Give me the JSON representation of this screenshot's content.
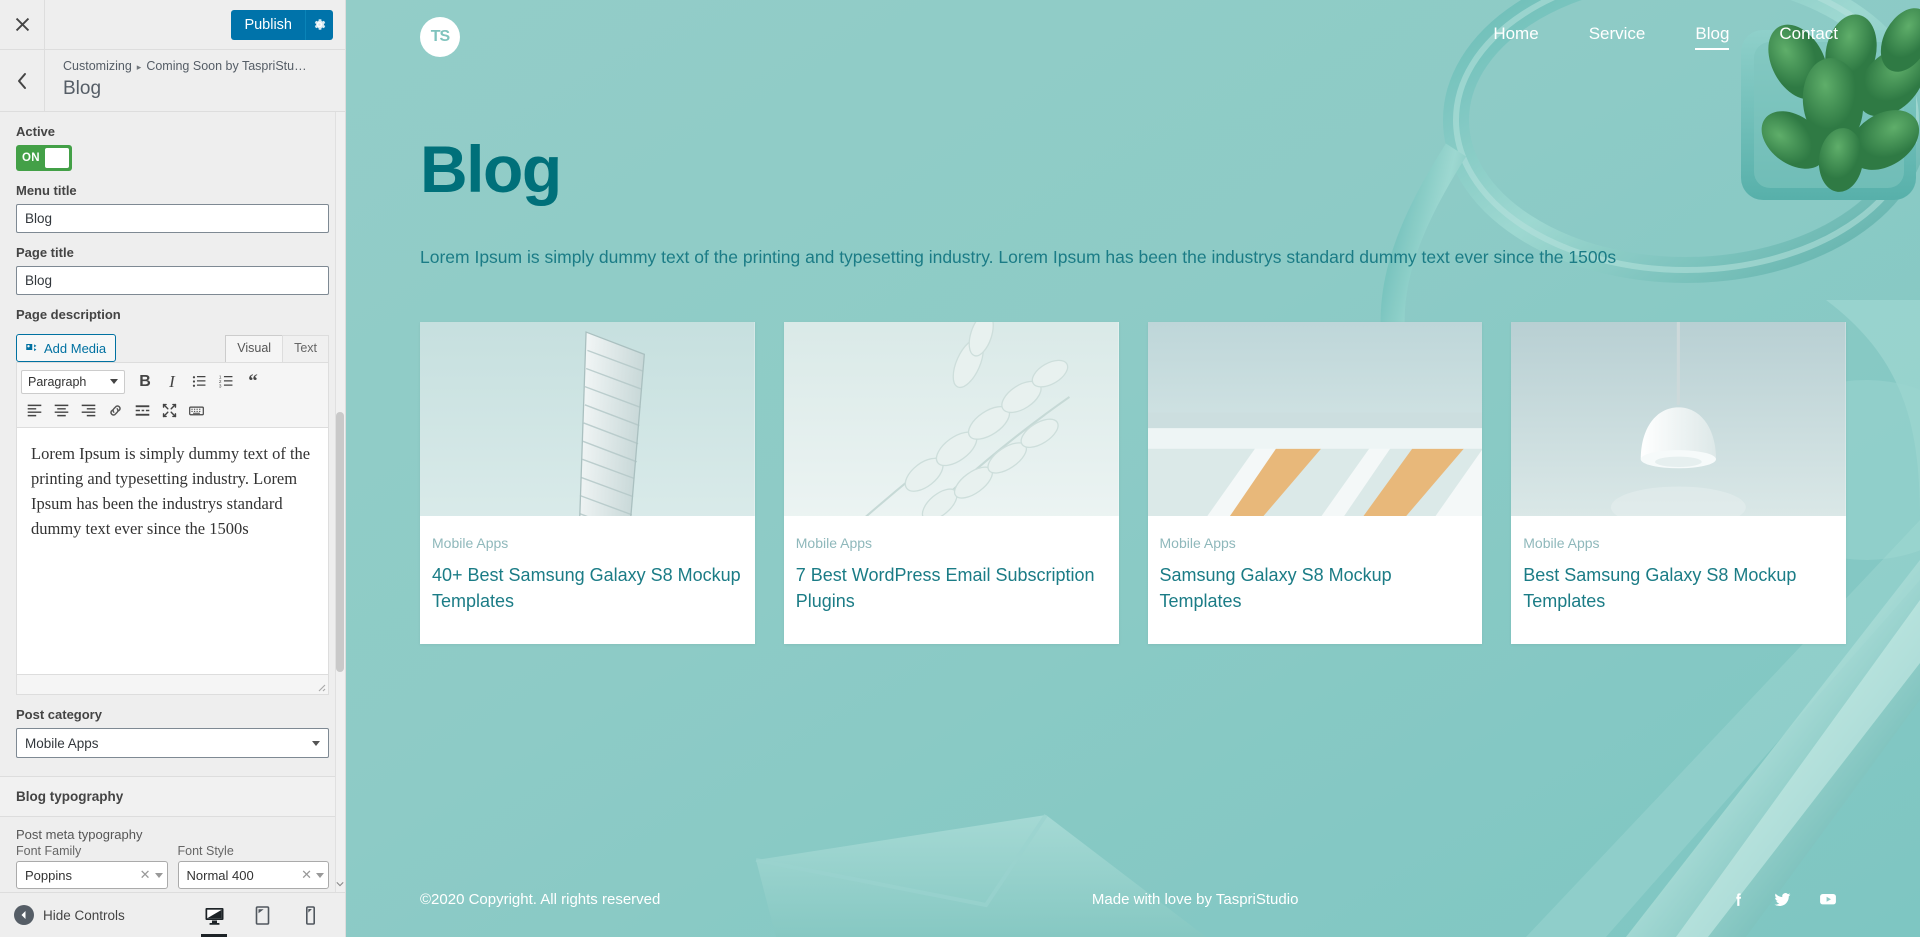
{
  "customizer": {
    "close_icon": "close-icon",
    "publish_label": "Publish",
    "gear_icon": "gear-icon",
    "back_icon": "chevron-left-icon",
    "breadcrumb_root": "Customizing",
    "breadcrumb_parent": "Coming Soon by TaspriStu…",
    "panel_title": "Blog",
    "controls": {
      "active_label": "Active",
      "active_state": "ON",
      "menu_title_label": "Menu title",
      "menu_title_value": "Blog",
      "page_title_label": "Page title",
      "page_title_value": "Blog",
      "page_description_label": "Page description",
      "add_media_label": "Add Media",
      "tab_visual": "Visual",
      "tab_text": "Text",
      "format_select": "Paragraph",
      "editor_content": "Lorem Ipsum is simply dummy text of the printing and typesetting industry. Lorem Ipsum has been the industrys standard dummy text ever since the 1500s",
      "post_category_label": "Post category",
      "post_category_value": "Mobile Apps"
    },
    "typography": {
      "section_title": "Blog typography",
      "subsection_title": "Post meta typography",
      "font_family_label": "Font Family",
      "font_family_value": "Poppins",
      "font_style_label": "Font Style",
      "font_style_value": "Normal 400"
    },
    "footer": {
      "hide_controls_label": "Hide Controls",
      "device_desktop": "desktop-icon",
      "device_tablet": "tablet-icon",
      "device_mobile": "mobile-icon"
    },
    "toolbar_buttons": [
      "bold-icon",
      "italic-icon",
      "bulleted-list-icon",
      "numbered-list-icon",
      "blockquote-icon",
      "align-left-icon",
      "align-center-icon",
      "align-right-icon",
      "link-icon",
      "read-more-icon",
      "fullscreen-icon",
      "toolbar-toggle-icon"
    ]
  },
  "site": {
    "logo_text": "TS",
    "nav": [
      {
        "label": "Home",
        "active": false
      },
      {
        "label": "Service",
        "active": false
      },
      {
        "label": "Blog",
        "active": true
      },
      {
        "label": "Contact",
        "active": false
      }
    ],
    "page_heading": "Blog",
    "page_subtitle": "Lorem Ipsum is simply dummy text of the printing and typesetting industry. Lorem Ipsum has been the industrys standard dummy text ever since the 1500s",
    "cards": [
      {
        "category": "Mobile Apps",
        "title": "40+ Best Samsung Galaxy S8 Mockup Templates",
        "image": "skyscraper-photo"
      },
      {
        "category": "Mobile Apps",
        "title": "7 Best WordPress Email Subscription Plugins",
        "image": "eucalyptus-leaves-photo"
      },
      {
        "category": "Mobile Apps",
        "title": "Samsung Galaxy S8 Mockup Templates",
        "image": "architecture-photo"
      },
      {
        "category": "Mobile Apps",
        "title": "Best Samsung Galaxy S8 Mockup Templates",
        "image": "pendant-lamp-photo"
      }
    ],
    "footer": {
      "copyright": "©2020 Copyright. All rights reserved",
      "made_with": "Made with love by TaspriStudio",
      "social": [
        "facebook-icon",
        "twitter-icon",
        "youtube-icon"
      ]
    }
  },
  "colors": {
    "publish_blue": "#0073aa",
    "toggle_green": "#43a047",
    "heading_teal": "#00707a",
    "body_teal": "#1b7c86",
    "bg_teal": "#8ecbc6"
  }
}
